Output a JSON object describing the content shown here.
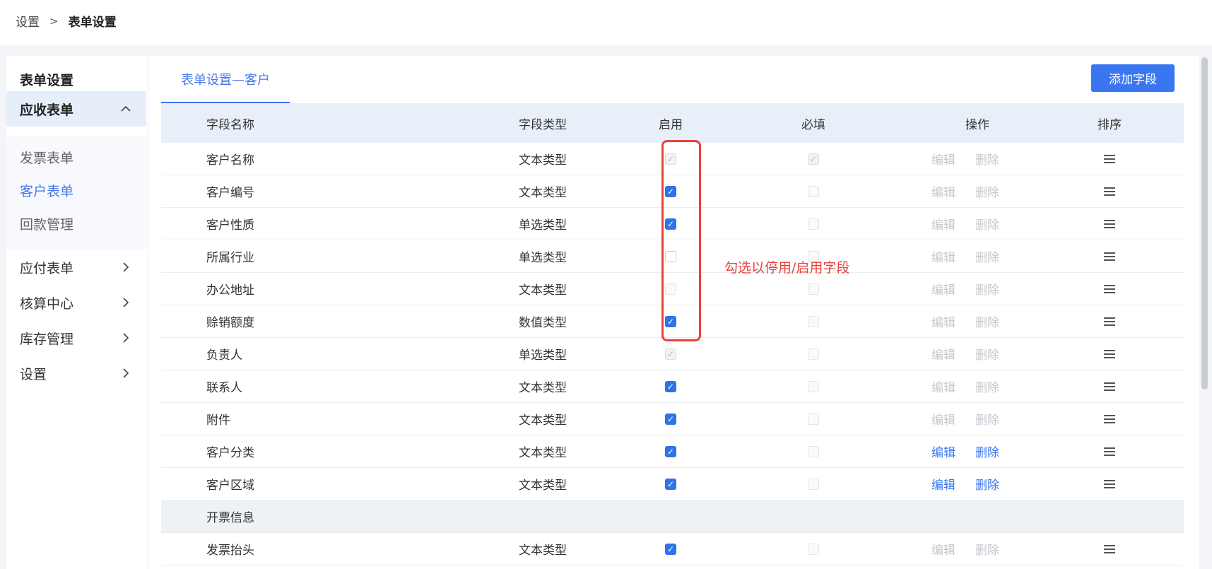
{
  "breadcrumb": {
    "items": [
      "设置",
      "表单设置"
    ],
    "separator": ">"
  },
  "sidebar": {
    "title": "表单设置",
    "groups": [
      {
        "label": "应收表单",
        "expanded": true,
        "icon": "chevron-up-icon"
      },
      {
        "label": "应付表单",
        "expanded": false,
        "icon": "chevron-right-icon"
      },
      {
        "label": "核算中心",
        "expanded": false,
        "icon": "chevron-right-icon"
      },
      {
        "label": "库存管理",
        "expanded": false,
        "icon": "chevron-right-icon"
      },
      {
        "label": "设置",
        "expanded": false,
        "icon": "chevron-right-icon"
      }
    ],
    "submenu": [
      {
        "label": "发票表单",
        "active": false
      },
      {
        "label": "客户表单",
        "active": true
      },
      {
        "label": "回款管理",
        "active": false
      }
    ]
  },
  "main": {
    "tab_label": "表单设置—客户",
    "add_button_label": "添加字段",
    "accent_color": "#3a76f0"
  },
  "table": {
    "headers": {
      "name": "字段名称",
      "type": "字段类型",
      "enable": "启用",
      "required": "必填",
      "ops": "操作",
      "sort": "排序"
    },
    "op_labels": {
      "edit": "编辑",
      "delete": "删除"
    },
    "rows": [
      {
        "name": "客户名称",
        "type": "文本类型",
        "enable": "disabled-checked",
        "required": "disabled-checked",
        "ops_enabled": false
      },
      {
        "name": "客户编号",
        "type": "文本类型",
        "enable": "checked",
        "required": "disabled",
        "ops_enabled": false
      },
      {
        "name": "客户性质",
        "type": "单选类型",
        "enable": "checked",
        "required": "disabled",
        "ops_enabled": false
      },
      {
        "name": "所属行业",
        "type": "单选类型",
        "enable": "unchecked",
        "required": "disabled",
        "ops_enabled": false
      },
      {
        "name": "办公地址",
        "type": "文本类型",
        "enable": "disabled",
        "required": "disabled",
        "ops_enabled": false
      },
      {
        "name": "赊销额度",
        "type": "数值类型",
        "enable": "checked",
        "required": "disabled",
        "ops_enabled": false
      },
      {
        "name": "负责人",
        "type": "单选类型",
        "enable": "disabled-checked",
        "required": "disabled",
        "ops_enabled": false
      },
      {
        "name": "联系人",
        "type": "文本类型",
        "enable": "checked",
        "required": "disabled",
        "ops_enabled": false
      },
      {
        "name": "附件",
        "type": "文本类型",
        "enable": "checked",
        "required": "disabled",
        "ops_enabled": false
      },
      {
        "name": "客户分类",
        "type": "文本类型",
        "enable": "checked",
        "required": "disabled",
        "ops_enabled": true
      },
      {
        "name": "客户区域",
        "type": "文本类型",
        "enable": "checked",
        "required": "disabled",
        "ops_enabled": true
      },
      {
        "group": true,
        "name": "开票信息"
      },
      {
        "name": "发票抬头",
        "type": "文本类型",
        "enable": "checked",
        "required": "disabled",
        "ops_enabled": false
      }
    ]
  },
  "annotation": {
    "text": "勾选以停用/启用字段",
    "color": "#e8423c"
  }
}
